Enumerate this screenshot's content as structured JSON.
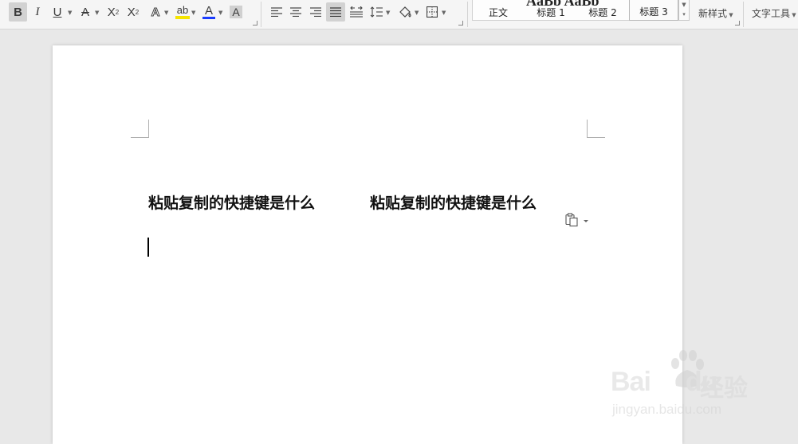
{
  "toolbar": {
    "font_format": {
      "bold": "B",
      "italic": "I",
      "underline": "U",
      "strikethrough": "A",
      "superscript": "X",
      "superscript_mark": "2",
      "subscript": "X",
      "subscript_mark": "2",
      "text_effect": "A",
      "highlight": "ab",
      "font_color": "A",
      "char_shading": "A"
    },
    "styles": {
      "items": [
        "正文",
        "标题 1",
        "标题 2",
        "标题 3"
      ],
      "selected": "标题 3",
      "new_style": "新样式",
      "text_tools": "文字工具"
    }
  },
  "document": {
    "lines": [
      "粘贴复制的快捷键是什么",
      "粘贴复制的快捷键是什么"
    ]
  },
  "watermark": {
    "brand": "Bai",
    "brand_tail": "du",
    "cn": "经验",
    "url": "jingyan.baidu.com"
  },
  "colors": {
    "highlight": "#f5e400",
    "font_color": "#1a3cff",
    "ribbon_bg": "#f5f5f5",
    "page_bg": "#e8e8e8"
  }
}
